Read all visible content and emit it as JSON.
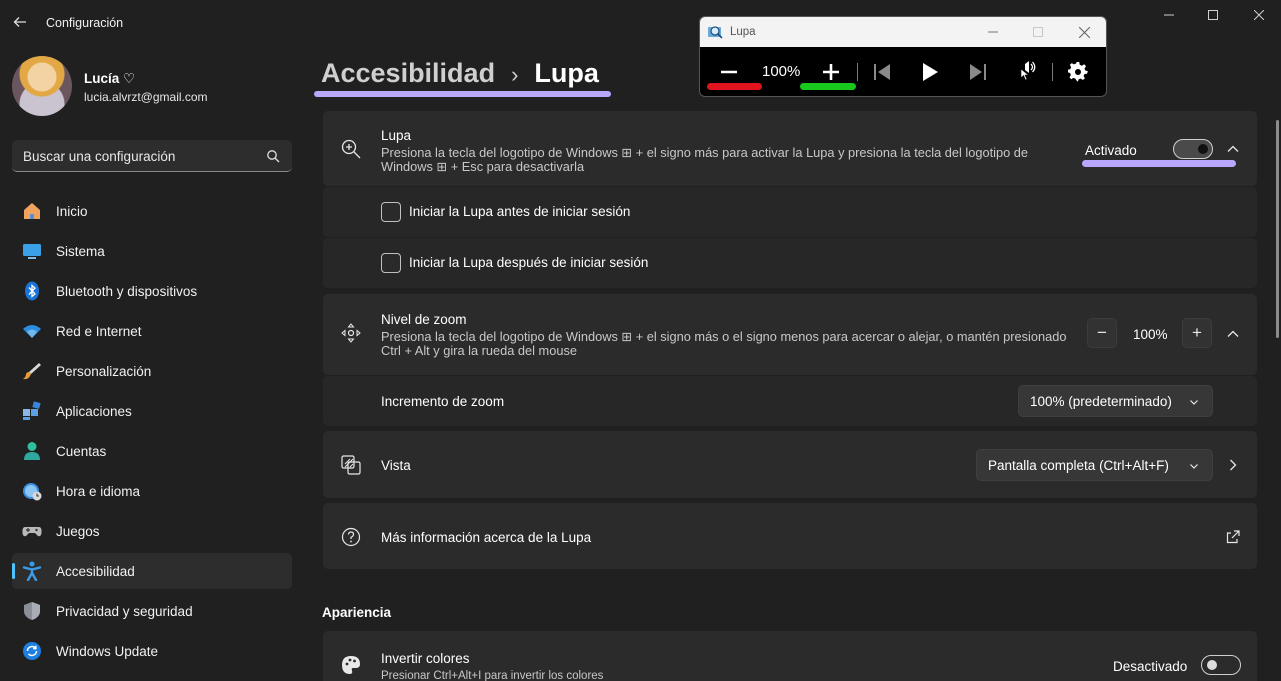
{
  "window": {
    "title": "Configuración"
  },
  "profile": {
    "name": "Lucía ♡",
    "email": "lucia.alvrzt@gmail.com"
  },
  "search": {
    "placeholder": "Buscar una configuración"
  },
  "sidebar": {
    "items": [
      {
        "label": "Inicio",
        "icon": "home-icon"
      },
      {
        "label": "Sistema",
        "icon": "monitor-icon"
      },
      {
        "label": "Bluetooth y dispositivos",
        "icon": "bluetooth-icon"
      },
      {
        "label": "Red e Internet",
        "icon": "wifi-icon"
      },
      {
        "label": "Personalización",
        "icon": "brush-icon"
      },
      {
        "label": "Aplicaciones",
        "icon": "apps-icon"
      },
      {
        "label": "Cuentas",
        "icon": "person-icon"
      },
      {
        "label": "Hora e idioma",
        "icon": "globe-clock-icon"
      },
      {
        "label": "Juegos",
        "icon": "gamepad-icon"
      },
      {
        "label": "Accesibilidad",
        "icon": "accessibility-icon",
        "active": true
      },
      {
        "label": "Privacidad y seguridad",
        "icon": "shield-icon"
      },
      {
        "label": "Windows Update",
        "icon": "update-icon"
      }
    ]
  },
  "breadcrumb": {
    "parent": "Accesibilidad",
    "separator": "›",
    "current": "Lupa"
  },
  "magnifier": {
    "title": "Lupa",
    "description": "Presiona la tecla del logotipo de Windows ⊞ + el signo más para activar la Lupa y presiona la tecla del logotipo de Windows ⊞ + Esc para desactivarla",
    "state_label": "Activado",
    "enabled": true,
    "options": [
      {
        "label": "Iniciar la Lupa antes de iniciar sesión",
        "checked": false
      },
      {
        "label": "Iniciar la Lupa después de iniciar sesión",
        "checked": false
      }
    ]
  },
  "zoom": {
    "title": "Nivel de zoom",
    "description": "Presiona la tecla del logotipo de Windows ⊞ + el signo más o el signo menos para acercar o alejar, o mantén presionado Ctrl + Alt y gira la rueda del mouse",
    "value": "100%",
    "decrease": "−",
    "increase": "+",
    "increment_label": "Incremento de zoom",
    "increment_value": "100% (predeterminado)"
  },
  "view": {
    "title": "Vista",
    "value": "Pantalla completa (Ctrl+Alt+F)"
  },
  "more_info": {
    "title": "Más información acerca de la Lupa"
  },
  "appearance": {
    "section_title": "Apariencia",
    "invert_title": "Invertir colores",
    "invert_desc": "Presionar Ctrl+Alt+I para invertir los colores",
    "invert_state": "Desactivado",
    "invert_enabled": false
  },
  "lupa_window": {
    "title": "Lupa",
    "zoom": "100%"
  },
  "colors": {
    "accent": "#4cc2ff",
    "highlight": "#b9a7ff",
    "red_marker": "#e0141e",
    "green_marker": "#18c81c"
  }
}
